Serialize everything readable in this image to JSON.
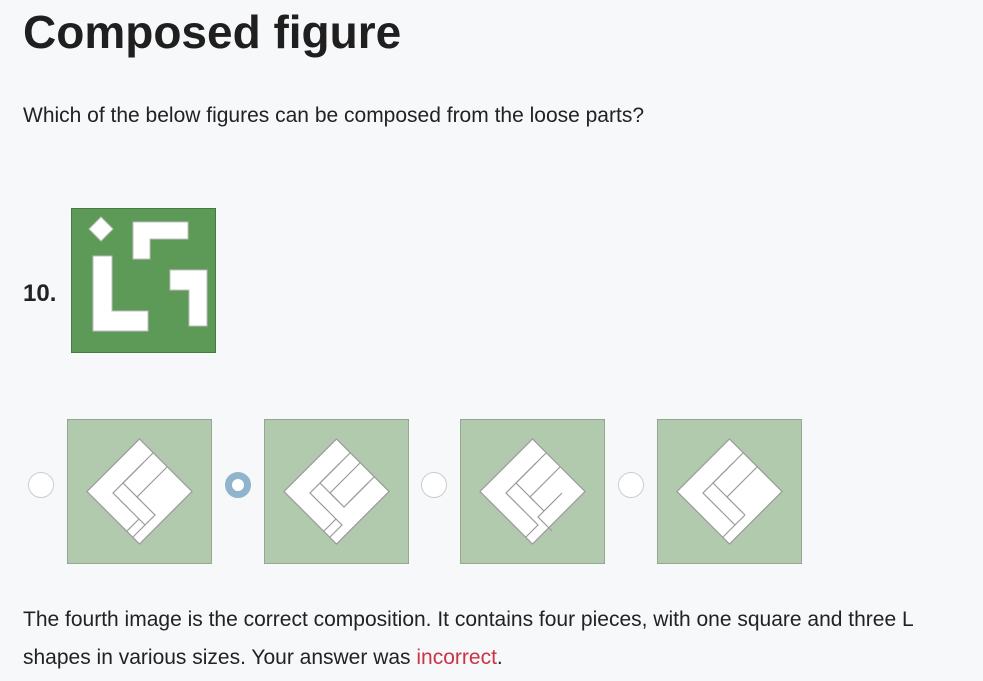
{
  "header": {
    "title": "Composed figure"
  },
  "question": {
    "prompt": "Which of the below figures can be composed from the loose parts?",
    "number": "10."
  },
  "parts_image": {
    "icon": "loose-parts-figure",
    "background_color": "#5e9a57"
  },
  "options": [
    {
      "icon": "composition-option-1",
      "selected": false
    },
    {
      "icon": "composition-option-2",
      "selected": true
    },
    {
      "icon": "composition-option-3",
      "selected": false
    },
    {
      "icon": "composition-option-4",
      "selected": false
    }
  ],
  "option_background_color": "#b1c9ad",
  "feedback": {
    "text_before": "The fourth image is the correct composition. It contains four pieces, with one square and three L shapes in various sizes. Your answer was ",
    "result_word": "incorrect",
    "text_after": ".",
    "result_color": "#cc3344"
  }
}
